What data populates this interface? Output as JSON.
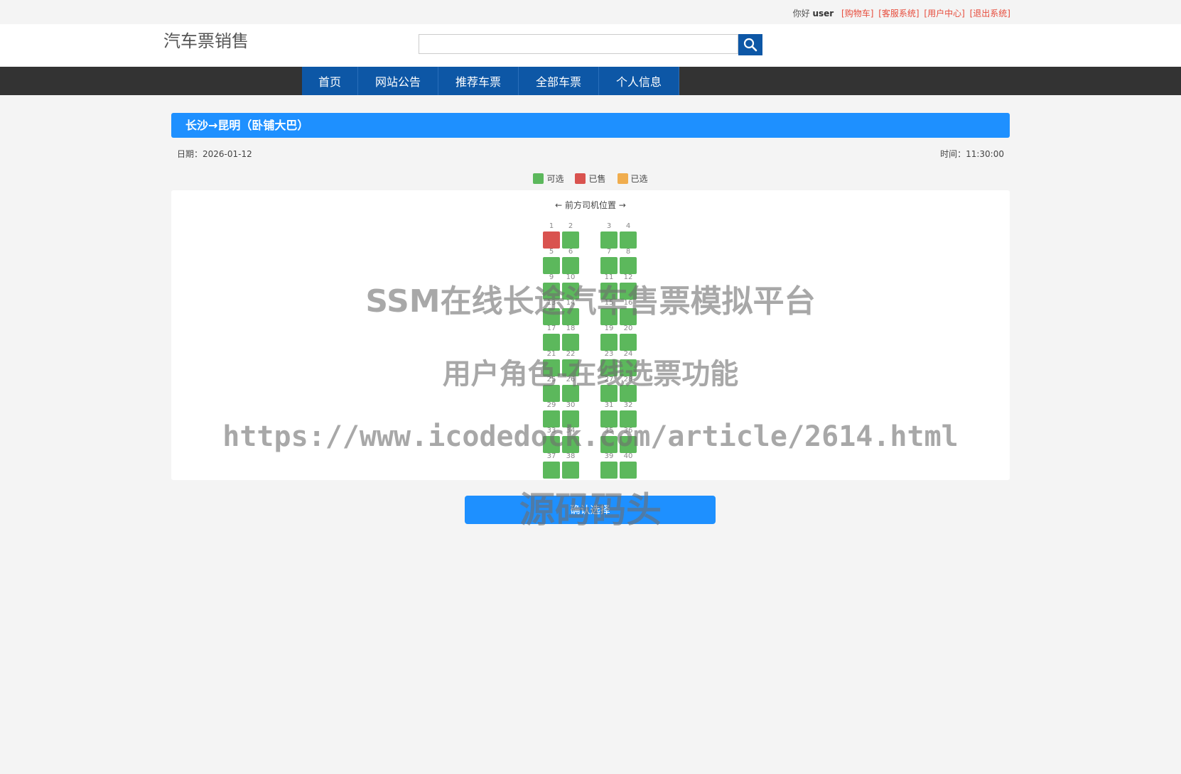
{
  "topbar": {
    "greeting": "你好",
    "username": "user",
    "links": [
      "[购物车]",
      "[客服系统]",
      "[用户中心]",
      "[退出系统]"
    ]
  },
  "header": {
    "logo": "汽车票销售",
    "search_placeholder": "",
    "search_icon": "search-icon"
  },
  "nav": {
    "items": [
      "首页",
      "网站公告",
      "推荐车票",
      "全部车票",
      "个人信息"
    ]
  },
  "route": {
    "title": "长沙→昆明（卧铺大巴）",
    "date_label": "日期：2026-01-12",
    "time_label": "时间：11:30:00"
  },
  "legend": {
    "available": "可选",
    "sold": "已售",
    "selected": "已选"
  },
  "colors": {
    "available": "#5cb85c",
    "sold": "#d9534f",
    "selected": "#f0ad4e",
    "accent": "#1e90ff",
    "nav": "#0d57a6"
  },
  "seatmap": {
    "driver_label": "← 前方司机位置 →",
    "seats": [
      {
        "n": "1",
        "status": "sold"
      },
      {
        "n": "2",
        "status": "available"
      },
      {
        "n": "3",
        "status": "available"
      },
      {
        "n": "4",
        "status": "available"
      },
      {
        "n": "5",
        "status": "available"
      },
      {
        "n": "6",
        "status": "available"
      },
      {
        "n": "7",
        "status": "available"
      },
      {
        "n": "8",
        "status": "available"
      },
      {
        "n": "9",
        "status": "available"
      },
      {
        "n": "10",
        "status": "available"
      },
      {
        "n": "11",
        "status": "available"
      },
      {
        "n": "12",
        "status": "available"
      },
      {
        "n": "13",
        "status": "available"
      },
      {
        "n": "14",
        "status": "available"
      },
      {
        "n": "15",
        "status": "available"
      },
      {
        "n": "16",
        "status": "available"
      },
      {
        "n": "17",
        "status": "available"
      },
      {
        "n": "18",
        "status": "available"
      },
      {
        "n": "19",
        "status": "available"
      },
      {
        "n": "20",
        "status": "available"
      },
      {
        "n": "21",
        "status": "available"
      },
      {
        "n": "22",
        "status": "available"
      },
      {
        "n": "23",
        "status": "available"
      },
      {
        "n": "24",
        "status": "available"
      },
      {
        "n": "25",
        "status": "available"
      },
      {
        "n": "26",
        "status": "available"
      },
      {
        "n": "27",
        "status": "available"
      },
      {
        "n": "28",
        "status": "available"
      },
      {
        "n": "29",
        "status": "available"
      },
      {
        "n": "30",
        "status": "available"
      },
      {
        "n": "31",
        "status": "available"
      },
      {
        "n": "32",
        "status": "available"
      },
      {
        "n": "33",
        "status": "available"
      },
      {
        "n": "34",
        "status": "available"
      },
      {
        "n": "35",
        "status": "available"
      },
      {
        "n": "36",
        "status": "available"
      },
      {
        "n": "37",
        "status": "available"
      },
      {
        "n": "38",
        "status": "available"
      },
      {
        "n": "39",
        "status": "available"
      },
      {
        "n": "40",
        "status": "available"
      }
    ]
  },
  "confirm_label": "确认选择",
  "watermark": {
    "line1": "SSM在线长途汽车售票模拟平台",
    "line2": "用户角色-在线选票功能",
    "line3": "https://www.icodedock.com/article/2614.html",
    "line4": "源码码头"
  }
}
